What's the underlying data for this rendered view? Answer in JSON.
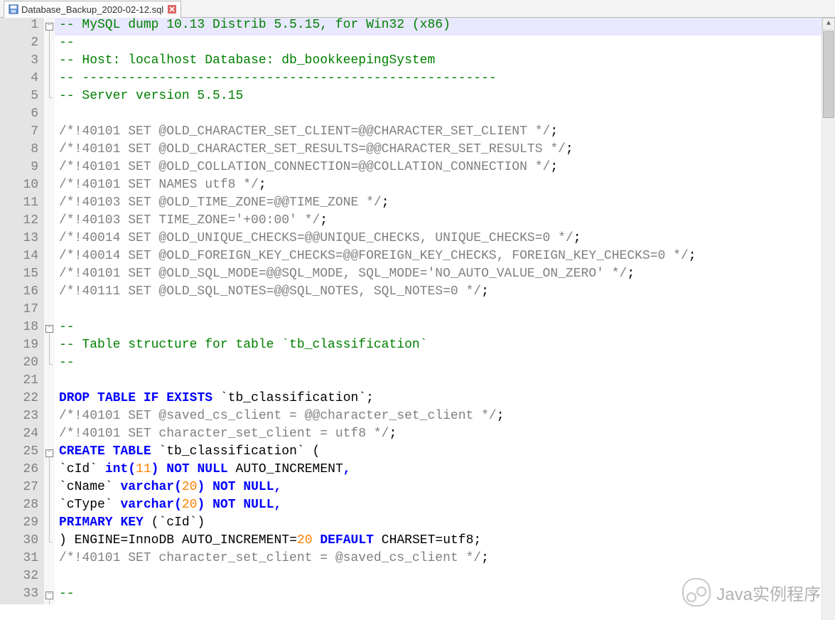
{
  "tab": {
    "filename": "Database_Backup_2020-02-12.sql"
  },
  "watermark": "Java实例程序",
  "lines": [
    {
      "n": 1,
      "fold": "minus",
      "hl": true,
      "html": "<span class='cgreen'>-- MySQL dump 10.13  Distrib 5.5.15, for Win32 (x86)</span>"
    },
    {
      "n": 2,
      "fold": "line",
      "html": "<span class='cgreen'>--</span>"
    },
    {
      "n": 3,
      "fold": "line",
      "html": "<span class='cgreen'>-- Host: localhost    Database: db_bookkeepingSystem</span>"
    },
    {
      "n": 4,
      "fold": "line",
      "html": "<span class='cgreen'>-- ------------------------------------------------------</span>"
    },
    {
      "n": 5,
      "fold": "end",
      "html": "<span class='cgreen'>-- Server version   5.5.15</span>"
    },
    {
      "n": 6,
      "fold": "",
      "html": ""
    },
    {
      "n": 7,
      "fold": "",
      "html": "<span class='cgray'>/*!40101 SET @OLD_CHARACTER_SET_CLIENT=@@CHARACTER_SET_CLIENT */</span><span class='cblk'>;</span>"
    },
    {
      "n": 8,
      "fold": "",
      "html": "<span class='cgray'>/*!40101 SET @OLD_CHARACTER_SET_RESULTS=@@CHARACTER_SET_RESULTS */</span><span class='cblk'>;</span>"
    },
    {
      "n": 9,
      "fold": "",
      "html": "<span class='cgray'>/*!40101 SET @OLD_COLLATION_CONNECTION=@@COLLATION_CONNECTION */</span><span class='cblk'>;</span>"
    },
    {
      "n": 10,
      "fold": "",
      "html": "<span class='cgray'>/*!40101 SET NAMES utf8 */</span><span class='cblk'>;</span>"
    },
    {
      "n": 11,
      "fold": "",
      "html": "<span class='cgray'>/*!40103 SET @OLD_TIME_ZONE=@@TIME_ZONE */</span><span class='cblk'>;</span>"
    },
    {
      "n": 12,
      "fold": "",
      "html": "<span class='cgray'>/*!40103 SET TIME_ZONE='+00:00' */</span><span class='cblk'>;</span>"
    },
    {
      "n": 13,
      "fold": "",
      "html": "<span class='cgray'>/*!40014 SET @OLD_UNIQUE_CHECKS=@@UNIQUE_CHECKS, UNIQUE_CHECKS=0 */</span><span class='cblk'>;</span>"
    },
    {
      "n": 14,
      "fold": "",
      "html": "<span class='cgray'>/*!40014 SET @OLD_FOREIGN_KEY_CHECKS=@@FOREIGN_KEY_CHECKS, FOREIGN_KEY_CHECKS=0 */</span><span class='cblk'>;</span>"
    },
    {
      "n": 15,
      "fold": "",
      "html": "<span class='cgray'>/*!40101 SET @OLD_SQL_MODE=@@SQL_MODE, SQL_MODE='NO_AUTO_VALUE_ON_ZERO' */</span><span class='cblk'>;</span>"
    },
    {
      "n": 16,
      "fold": "",
      "html": "<span class='cgray'>/*!40111 SET @OLD_SQL_NOTES=@@SQL_NOTES, SQL_NOTES=0 */</span><span class='cblk'>;</span>"
    },
    {
      "n": 17,
      "fold": "",
      "html": ""
    },
    {
      "n": 18,
      "fold": "minus",
      "html": "<span class='cgreen'>--</span>"
    },
    {
      "n": 19,
      "fold": "line",
      "html": "<span class='cgreen'>-- Table structure for table `tb_classification`</span>"
    },
    {
      "n": 20,
      "fold": "end",
      "html": "<span class='cgreen'>--</span>"
    },
    {
      "n": 21,
      "fold": "",
      "html": ""
    },
    {
      "n": 22,
      "fold": "",
      "html": "<span class='cblue'>DROP</span> <span class='cblue'>TABLE</span> <span class='cblue'>IF</span> <span class='cblue'>EXISTS</span> <span class='cblk'>`tb_classification`</span><span class='cblk'>;</span>"
    },
    {
      "n": 23,
      "fold": "",
      "html": "<span class='cgray'>/*!40101 SET @saved_cs_client     = @@character_set_client */</span><span class='cblk'>;</span>"
    },
    {
      "n": 24,
      "fold": "",
      "html": "<span class='cgray'>/*!40101 SET character_set_client = utf8 */</span><span class='cblk'>;</span>"
    },
    {
      "n": 25,
      "fold": "minus",
      "html": "<span class='cblue'>CREATE</span> <span class='cblue'>TABLE</span> <span class='cblk'>`tb_classification`</span> <span class='cblk'>(</span>"
    },
    {
      "n": 26,
      "fold": "line",
      "html": "  <span class='cblk'>`cId`</span> <span class='cblue'>int</span><span class='cblue'>(</span><span class='corg'>11</span><span class='cblue'>)</span> <span class='cblue'>NOT</span> <span class='cblue'>NULL</span> <span class='cblk'>AUTO_INCREMENT</span><span class='cblue'>,</span>"
    },
    {
      "n": 27,
      "fold": "line",
      "html": "  <span class='cblk'>`cName`</span> <span class='cblue'>varchar</span><span class='cblue'>(</span><span class='corg'>20</span><span class='cblue'>)</span> <span class='cblue'>NOT</span> <span class='cblue'>NULL</span><span class='cblue'>,</span>"
    },
    {
      "n": 28,
      "fold": "line",
      "html": "  <span class='cblk'>`cType`</span> <span class='cblue'>varchar</span><span class='cblue'>(</span><span class='corg'>20</span><span class='cblue'>)</span> <span class='cblue'>NOT</span> <span class='cblue'>NULL</span><span class='cblue'>,</span>"
    },
    {
      "n": 29,
      "fold": "line",
      "html": "  <span class='cblue'>PRIMARY</span> <span class='cblue'>KEY</span> <span class='cblk'>(</span><span class='cblk'>`cId`</span><span class='cblk'>)</span>"
    },
    {
      "n": 30,
      "fold": "end",
      "html": "<span class='cblk'>)</span> <span class='cblk'>ENGINE</span><span class='cblk'>=</span><span class='cblk'>InnoDB AUTO_INCREMENT</span><span class='cblk'>=</span><span class='corg'>20</span> <span class='cblue'>DEFAULT</span> <span class='cblk'>CHARSET</span><span class='cblk'>=</span><span class='cblk'>utf8</span><span class='cblk'>;</span>"
    },
    {
      "n": 31,
      "fold": "",
      "html": "<span class='cgray'>/*!40101 SET character_set_client = @saved_cs_client */</span><span class='cblk'>;</span>"
    },
    {
      "n": 32,
      "fold": "",
      "html": ""
    },
    {
      "n": 33,
      "fold": "minus",
      "html": "<span class='cgreen'>--</span>"
    }
  ]
}
